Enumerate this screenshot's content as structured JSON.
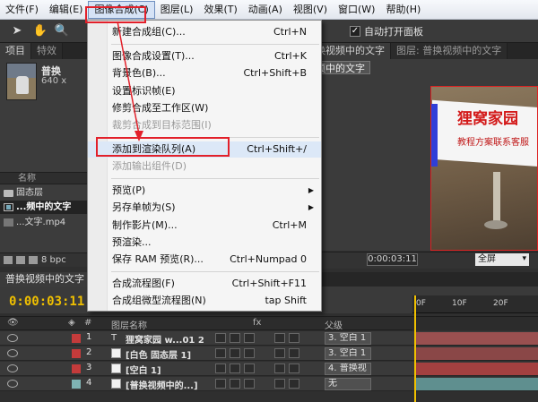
{
  "menubar": {
    "items": [
      "文件(F)",
      "编辑(E)",
      "图像合成(C)",
      "图层(L)",
      "效果(T)",
      "动画(A)",
      "视图(V)",
      "窗口(W)",
      "帮助(H)"
    ],
    "active_index": 2
  },
  "toolbar": {
    "auto_open_panel": "自动打开面板",
    "auto_open_checked": "✓"
  },
  "project_panel": {
    "tabs": [
      "项目",
      "特效"
    ],
    "name": "普换",
    "dims": "640 x",
    "list_header": "名称",
    "items": [
      "固态层",
      "...频中的文字",
      "...文字.mp4"
    ],
    "footer_bpc": "8 bpc"
  },
  "viewer": {
    "tabs": [
      "换视频中的文字",
      "图层: 普换视频中的文字"
    ],
    "breadcrumb": "频中的文字",
    "text_title": "狸窝家园",
    "text_sub": "教程方案联系客服",
    "timecode": "0:00:03:11",
    "view_mode": "全屏"
  },
  "timeline": {
    "tab_label": "普换视频中的文字",
    "current_time": "0:00:03:11",
    "ruler_ticks": [
      "0F",
      "10F",
      "20F"
    ],
    "headers": {
      "name": "图层名称",
      "parent": "父级",
      "fx": "fx"
    },
    "layers": [
      {
        "num": "1",
        "name": "狸窝家园  w...01 2",
        "parent": "3. 空白 1",
        "label_color": "#c43b3b",
        "type": "T",
        "bar_color": "#9a5050"
      },
      {
        "num": "2",
        "name": "[白色 固态层 1]",
        "parent": "3. 空白 1",
        "label_color": "#c43b3b",
        "type": "",
        "bar_color": "#8a4747"
      },
      {
        "num": "3",
        "name": "[空白 1]",
        "parent": "4. 普换视",
        "label_color": "#c43b3b",
        "type": "",
        "bar_color": "#a34040"
      },
      {
        "num": "4",
        "name": "[普换视频中的...]",
        "parent": "无",
        "label_color": "#7fb3b3",
        "type": "",
        "bar_color": "#5f8f8f"
      }
    ]
  },
  "context_menu": {
    "items": [
      {
        "label": "新建合成组(C)...",
        "shortcut": "Ctrl+N"
      },
      {
        "label": "图像合成设置(T)...",
        "shortcut": "Ctrl+K"
      },
      {
        "label": "背景色(B)...",
        "shortcut": "Ctrl+Shift+B"
      },
      {
        "label": "设置标识帧(E)",
        "shortcut": ""
      },
      {
        "label": "修剪合成至工作区(W)",
        "shortcut": ""
      },
      {
        "label": "裁剪合成到目标范围(I)",
        "shortcut": ""
      },
      {
        "label": "添加到渲染队列(A)",
        "shortcut": "Ctrl+Shift+/"
      },
      {
        "label": "添加输出组件(D)",
        "shortcut": ""
      },
      {
        "label": "预览(P)",
        "shortcut": ""
      },
      {
        "label": "另存单帧为(S)",
        "shortcut": ""
      },
      {
        "label": "制作影片(M)...",
        "shortcut": "Ctrl+M"
      },
      {
        "label": "预渲染...",
        "shortcut": ""
      },
      {
        "label": "保存 RAM 预览(R)...",
        "shortcut": "Ctrl+Numpad 0"
      },
      {
        "label": "合成流程图(F)",
        "shortcut": "Ctrl+Shift+F11"
      },
      {
        "label": "合成组微型流程图(N)",
        "shortcut": "tap Shift"
      }
    ]
  }
}
